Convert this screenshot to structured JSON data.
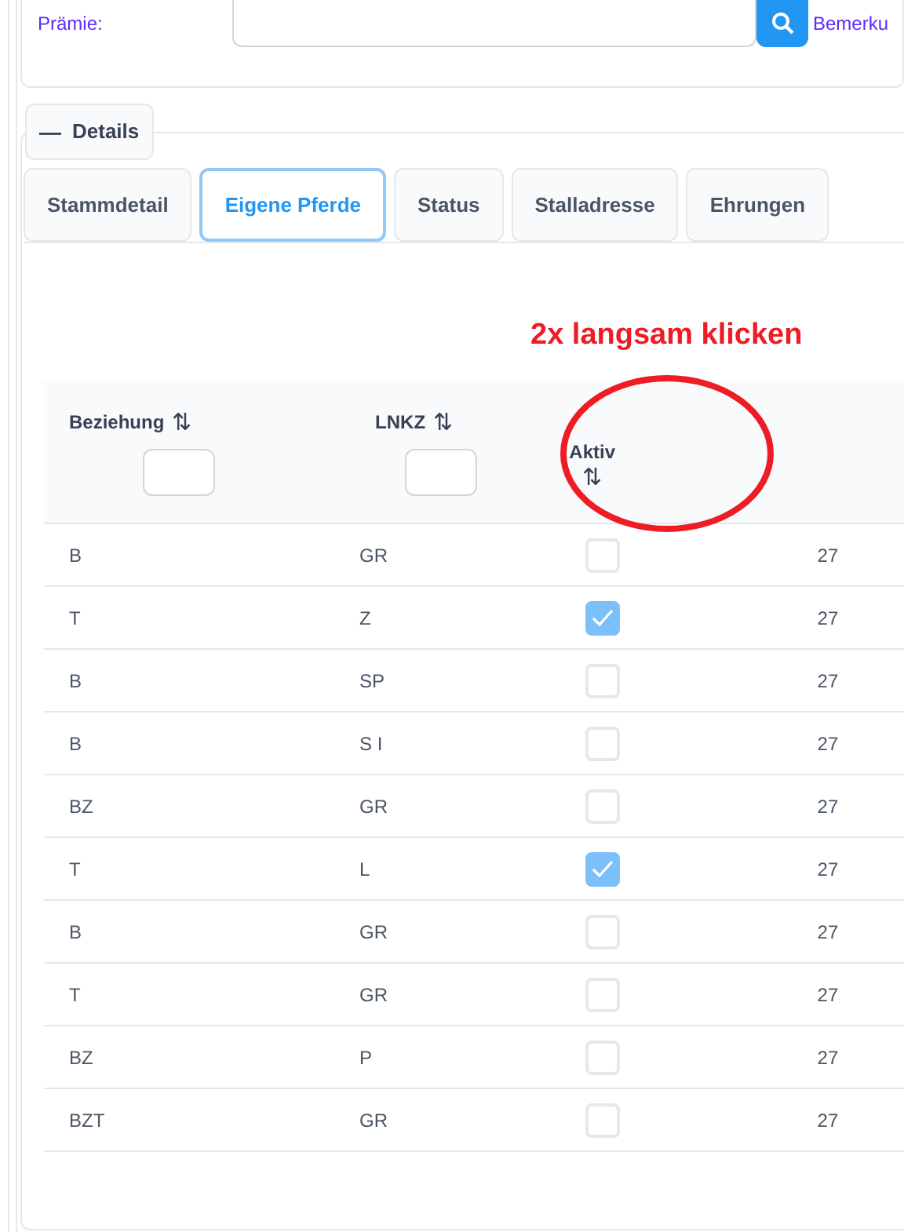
{
  "top_panel": {
    "label": "Prämie:",
    "next_label": "Bemerku"
  },
  "details": {
    "toggle": "—",
    "legend": "Details"
  },
  "tabs": [
    {
      "label": "Stammdetail",
      "selected": false
    },
    {
      "label": "Eigene Pferde",
      "selected": true
    },
    {
      "label": "Status",
      "selected": false
    },
    {
      "label": "Stalladresse",
      "selected": false
    },
    {
      "label": "Ehrungen",
      "selected": false
    }
  ],
  "annotation": {
    "text": "2x langsam klicken"
  },
  "table": {
    "columns": [
      {
        "label": "Beziehung",
        "sort": "⇅",
        "filter": true
      },
      {
        "label": "LNKZ",
        "sort": "⇅",
        "filter": true
      },
      {
        "label": "Aktiv",
        "sort": "⇅",
        "filter": false
      }
    ],
    "rows": [
      {
        "beziehung": "B",
        "lnkz": "GR",
        "aktiv": false,
        "column_4": "27"
      },
      {
        "beziehung": "T",
        "lnkz": "Z",
        "aktiv": true,
        "column_4": "27"
      },
      {
        "beziehung": "B",
        "lnkz": "SP",
        "aktiv": false,
        "column_4": "27"
      },
      {
        "beziehung": "B",
        "lnkz": "S I",
        "aktiv": false,
        "column_4": "27"
      },
      {
        "beziehung": "BZ",
        "lnkz": "GR",
        "aktiv": false,
        "column_4": "27"
      },
      {
        "beziehung": "T",
        "lnkz": "L",
        "aktiv": true,
        "column_4": "27"
      },
      {
        "beziehung": "B",
        "lnkz": "GR",
        "aktiv": false,
        "column_4": "27"
      },
      {
        "beziehung": "T",
        "lnkz": "GR",
        "aktiv": false,
        "column_4": "27"
      },
      {
        "beziehung": "BZ",
        "lnkz": "P",
        "aktiv": false,
        "column_4": "27"
      },
      {
        "beziehung": "BZT",
        "lnkz": "GR",
        "aktiv": false,
        "column_4": "27"
      }
    ]
  }
}
